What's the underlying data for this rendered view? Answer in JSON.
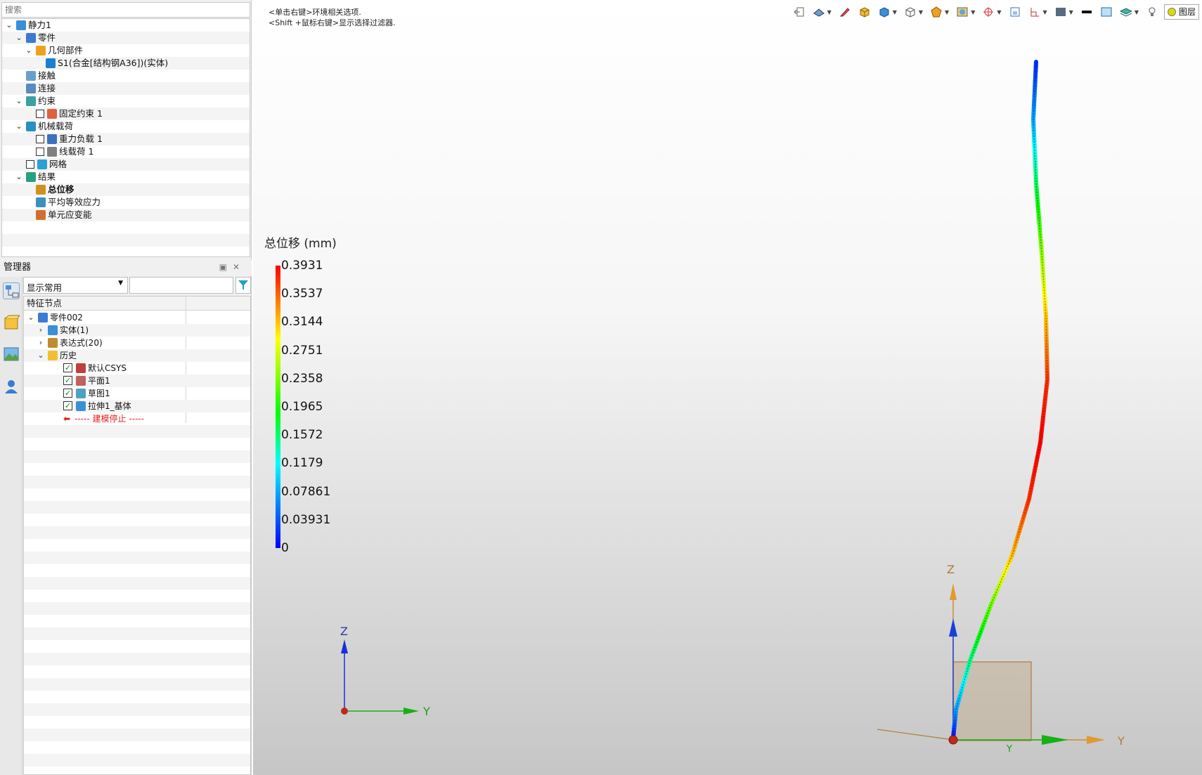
{
  "search": {
    "placeholder": "搜索"
  },
  "sim_tree": [
    {
      "label": "静力1",
      "indent": 0,
      "expanded": true
    },
    {
      "label": "零件",
      "indent": 1,
      "expanded": true
    },
    {
      "label": "几何部件",
      "indent": 2,
      "expanded": true
    },
    {
      "label": "S1(合金[结构钢A36])(实体)",
      "indent": 3
    },
    {
      "label": "接触",
      "indent": 1
    },
    {
      "label": "连接",
      "indent": 1
    },
    {
      "label": "约束",
      "indent": 1,
      "expanded": true
    },
    {
      "label": "固定约束 1",
      "indent": 2,
      "checkbox": true
    },
    {
      "label": "机械载荷",
      "indent": 1,
      "expanded": true
    },
    {
      "label": "重力负载 1",
      "indent": 2,
      "checkbox": true
    },
    {
      "label": "线载荷 1",
      "indent": 2,
      "checkbox": true
    },
    {
      "label": "网格",
      "indent": 1,
      "checkbox": true
    },
    {
      "label": "结果",
      "indent": 1,
      "expanded": true
    },
    {
      "label": "总位移",
      "indent": 2,
      "bold": true
    },
    {
      "label": "平均等效应力",
      "indent": 2
    },
    {
      "label": "单元应变能",
      "indent": 2
    }
  ],
  "manager": {
    "title": "管理器",
    "filter_value": "显示常用",
    "column_header": "特征节点",
    "rows": [
      {
        "label": "零件002",
        "indent": 0,
        "expander": "open"
      },
      {
        "label": "实体(1)",
        "indent": 1,
        "expander": "closed"
      },
      {
        "label": "表达式(20)",
        "indent": 1,
        "expander": "closed"
      },
      {
        "label": "历史",
        "indent": 1,
        "expander": "open"
      },
      {
        "label": "默认CSYS",
        "indent": 2,
        "checked": true
      },
      {
        "label": "平面1",
        "indent": 2,
        "checked": true
      },
      {
        "label": "草图1",
        "indent": 2,
        "checked": true
      },
      {
        "label": "拉伸1_基体",
        "indent": 2,
        "checked": true
      },
      {
        "label": "----- 建模停止 -----",
        "indent": 2,
        "stop": true
      }
    ]
  },
  "viewport": {
    "hint_line1": "<单击右键>环境相关选项.",
    "hint_line2": "<Shift +鼠标右键>显示选择过滤器.",
    "layer_button": "图层",
    "toolbar_icons": [
      "exit-icon",
      "view-orient-icon",
      "pencil-icon",
      "shaded-cube-icon",
      "blue-cube-icon",
      "wireframe-cube-icon",
      "render-style-icon",
      "display-filter-icon",
      "snap-target-icon",
      "frame-icon",
      "section-icon",
      "background-icon",
      "line-icon",
      "window-icon",
      "layer-stack-icon"
    ]
  },
  "legend": {
    "title": "总位移 (mm)",
    "values": [
      "0.3931",
      "0.3537",
      "0.3144",
      "0.2751",
      "0.2358",
      "0.1965",
      "0.1572",
      "0.1179",
      "0.07861",
      "0.03931",
      "0"
    ]
  },
  "triad_small": {
    "z_label": "Z",
    "y_label": "Y"
  },
  "triad_part": {
    "z_label": "Z",
    "y_label": "Y",
    "y_label_inner": "Y"
  },
  "colors": {
    "accent": "#1a73e8",
    "stop_red": "#e02020"
  }
}
